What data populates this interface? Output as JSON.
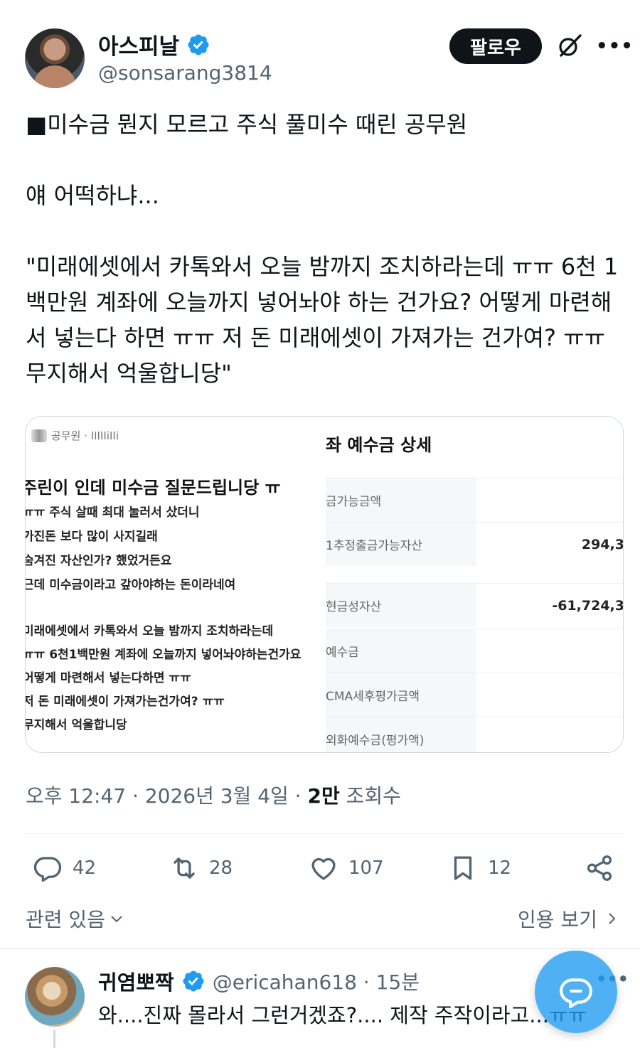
{
  "author": {
    "display_name": "아스피날",
    "handle": "@sonsarang3814",
    "verified": true
  },
  "header": {
    "follow_label": "팔로우",
    "grok_icon": "grok-icon",
    "more_icon": "more-icon"
  },
  "tweet": {
    "text": "■미수금 뭔지 모르고 주식 풀미수 때린 공무원\n\n얘 어떡하냐...\n\n\"미래에셋에서 카톡와서 오늘 밤까지 조치하라는데 ㅠㅠ 6천 1백만원 계좌에 오늘까지 넣어놔야 하는 건가요? 어떻게 마련해서 넣는다 하면 ㅠㅠ 저 돈 미래에셋이 가져가는 건가여? ㅠㅠ 무지해서 억울합니당\"",
    "timestamp": "오후 12:47 · 2026년 3월 4일 · ",
    "views_count": "2만",
    "views_label": " 조회수"
  },
  "media": {
    "left": {
      "meta": "공무원 · IIIIIiIIi",
      "title": "주린이 인데 미수금 질문드립니당 ㅠ",
      "lines": [
        "ㅠㅠ 주식 살때 최대 눌러서 샀더니",
        "가진돈 보다 많이 사지길래",
        "숨겨진 자산인가? 했었거든요",
        "근데 미수금이라고 갚아야하는 돈이라네여",
        "미래에셋에서 카톡와서 오늘 밤까지 조치하라는데",
        "ㅠㅠ 6천1백만원 계좌에 오늘까지 넣어놔야하는건가요",
        "어떻게 마련해서 넣는다하면 ㅠㅠ",
        "저 돈 미래에셋이 가져가는건가여? ㅠㅠ",
        "무지해서 억울합니당"
      ]
    },
    "right": {
      "title": "좌 예수금 상세",
      "rows": [
        {
          "label": "금가능금액",
          "value": ""
        },
        {
          "label": "1추정출금가능자산",
          "value": "294,3"
        },
        {
          "label": "현금성자산",
          "value": "-61,724,3"
        },
        {
          "label": "예수금",
          "value": ""
        },
        {
          "label": "CMA세후평가금액",
          "value": ""
        },
        {
          "label": "외화예수금(평가액)",
          "value": ""
        }
      ]
    }
  },
  "actions": {
    "replies": "42",
    "reposts": "28",
    "likes": "107",
    "bookmarks": "12"
  },
  "links": {
    "related": "관련 있음",
    "quotes": "인용 보기"
  },
  "reply": {
    "display_name": "귀염뽀짝",
    "handle": "@ericahan618 · 15분",
    "text": "와....진짜 몰라서 그런거겠죠?.... 제작 주작이라고...ㅠㅠ"
  },
  "colors": {
    "text": "#0f1419",
    "secondary": "#536471",
    "verified_blue": "#1d9bf0",
    "fab_blue": "#1d9bf0"
  }
}
